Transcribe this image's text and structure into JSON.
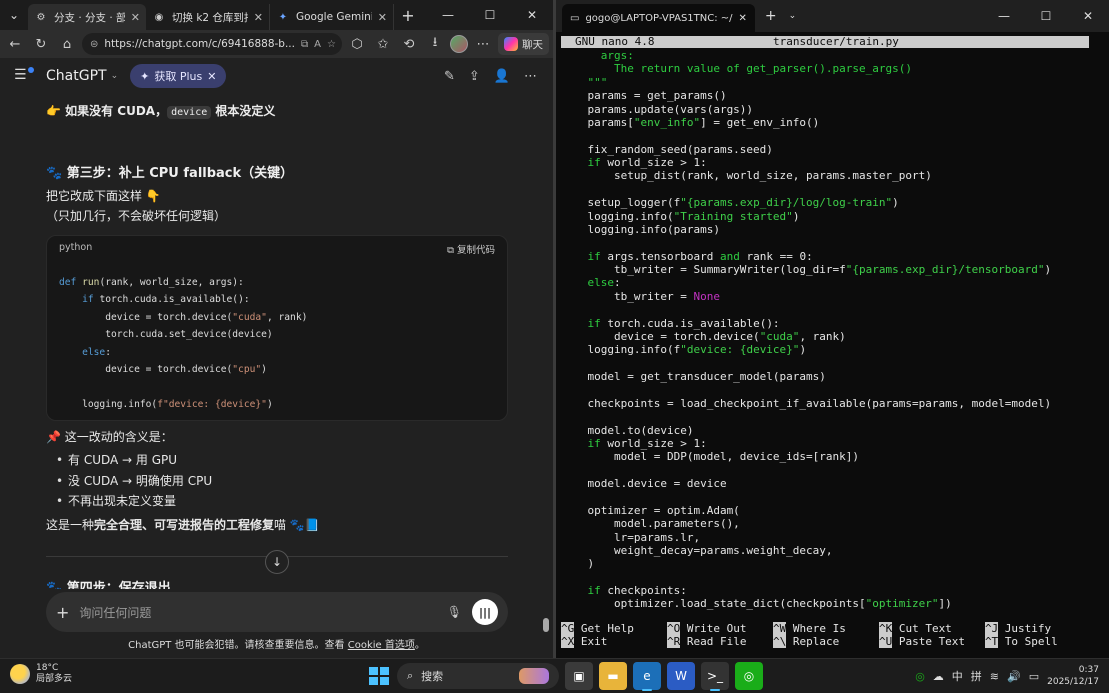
{
  "browser": {
    "tabs": [
      {
        "label": "分支 · 分支 · 部署Kaldi",
        "icon": "gear-icon"
      },
      {
        "label": "切换 k2 仓库到指定",
        "icon": "github-icon"
      },
      {
        "label": "Google Gemini",
        "icon": "gemini-icon"
      }
    ],
    "url": "https://chatgpt.com/c/69416888-b...",
    "copilot_label": "聊天"
  },
  "chatgpt": {
    "title": "ChatGPT",
    "plus_label": "获取 Plus",
    "line_no_cuda_prefix": "👉 如果没有 CUDA，",
    "line_no_cuda_code": "device",
    "line_no_cuda_suffix": " 根本没定义",
    "step3_title": "🐾 第三步：补上 CPU fallback（关键）",
    "step3_p1": "把它改成下面这样 👇",
    "step3_p2": "（只加几行，不会破坏任何逻辑）",
    "code_lang": "python",
    "copy_label": "复制代码",
    "meaning_title": "📌 这一改动的含义是：",
    "bullets": [
      "有 CUDA → 用 GPU",
      "没 CUDA → 明确使用 CPU",
      "不再出现未定义变量"
    ],
    "summary_prefix": "这是一种",
    "summary_bold": "完全合理、可写进报告的工程修复",
    "summary_suffix": "喵 🐾📘",
    "step4_title": "🐾 第四步：保存退出",
    "composer_placeholder": "询问任何问题",
    "disclaimer_prefix": "ChatGPT 也可能会犯错。请核查重要信息。查看 ",
    "disclaimer_link": "Cookie 首选项",
    "disclaimer_suffix": "。"
  },
  "terminal": {
    "tab_title": "gogo@LAPTOP-VPAS1TNC: ~/",
    "nano_version": "GNU nano 4.8",
    "file_name": "transducer/train.py",
    "shortcuts": [
      {
        "key": "^G",
        "label": "Get Help"
      },
      {
        "key": "^O",
        "label": "Write Out"
      },
      {
        "key": "^W",
        "label": "Where Is"
      },
      {
        "key": "^K",
        "label": "Cut Text"
      },
      {
        "key": "^J",
        "label": "Justify"
      },
      {
        "key": "^X",
        "label": "Exit"
      },
      {
        "key": "^R",
        "label": "Read File"
      },
      {
        "key": "^\\",
        "label": "Replace"
      },
      {
        "key": "^U",
        "label": "Paste Text"
      },
      {
        "key": "^T",
        "label": "To Spell"
      }
    ]
  },
  "taskbar": {
    "temperature": "18°C",
    "weather": "局部多云",
    "search_label": "搜索",
    "ime_lang": "中",
    "ime_mode": "拼",
    "time": "0:37",
    "date": "2025/12/17"
  }
}
